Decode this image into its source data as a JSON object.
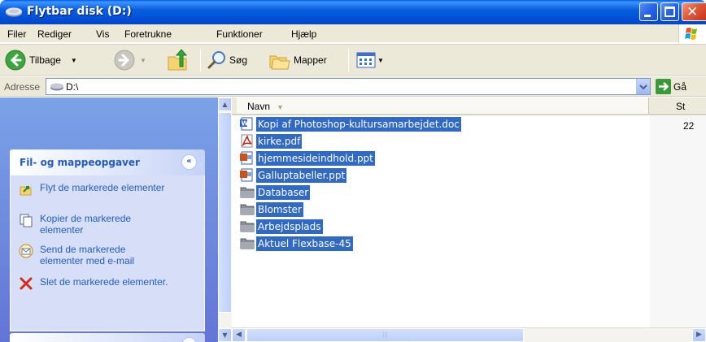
{
  "window": {
    "title": "Flytbar disk (D:)"
  },
  "menu": {
    "items": [
      "Filer",
      "Rediger",
      "Vis",
      "Foretrukne",
      "Funktioner",
      "Hjælp"
    ]
  },
  "toolbar": {
    "back_label": "Tilbage",
    "search_label": "Søg",
    "folders_label": "Mapper"
  },
  "address": {
    "label": "Adresse",
    "value": "D:\\",
    "go_label": "Gå"
  },
  "tasks": {
    "title": "Fil- og mappeopgaver",
    "items": [
      {
        "label": "Flyt de markerede elementer",
        "icon": "move-icon"
      },
      {
        "label": "Kopier de markerede elementer",
        "icon": "copy-icon"
      },
      {
        "label": "Send de markerede elementer med e-mail",
        "icon": "email-icon"
      },
      {
        "label": "Slet de markerede elementer.",
        "icon": "delete-icon"
      }
    ]
  },
  "filelist": {
    "col_name": "Navn",
    "col_size": "St",
    "first_size": "22",
    "files": [
      {
        "name": "Kopi af Photoshop-kultursamarbejdet.doc",
        "type": "doc"
      },
      {
        "name": "kirke.pdf",
        "type": "pdf"
      },
      {
        "name": "hjemmesideindhold.ppt",
        "type": "ppt"
      },
      {
        "name": "Galluptabeller.ppt",
        "type": "ppt"
      },
      {
        "name": "Databaser",
        "type": "folder"
      },
      {
        "name": "Blomster",
        "type": "folder"
      },
      {
        "name": "Arbejdsplads",
        "type": "folder"
      },
      {
        "name": "Aktuel Flexbase-45",
        "type": "folder"
      }
    ]
  },
  "colors": {
    "selection": "#316ac5",
    "title_blue": "#0352d8",
    "task_link": "#215dc6"
  }
}
